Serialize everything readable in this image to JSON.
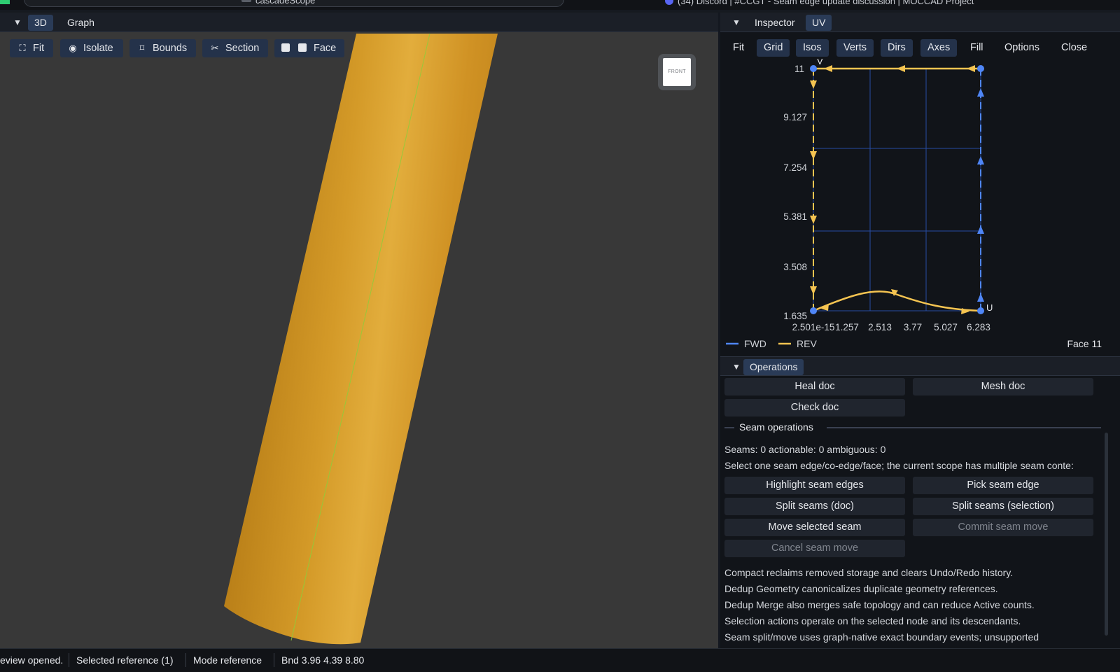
{
  "window": {
    "tab_title": "cascadeScope",
    "right_title": "(34) Discord | #CCGT - Seam edge update discussion | MOCCAD Project"
  },
  "left_panel": {
    "tabs": [
      {
        "label": "3D",
        "active": true
      },
      {
        "label": "Graph",
        "active": false
      }
    ],
    "toolbar": [
      {
        "label": "Fit",
        "icon": "fit-frame-icon"
      },
      {
        "label": "Isolate",
        "icon": "eye-icon"
      },
      {
        "label": "Bounds",
        "icon": "bounds-icon"
      },
      {
        "label": "Section",
        "icon": "scissors-icon"
      },
      {
        "label": "Face",
        "icon": "checkbox-icon"
      }
    ],
    "viewcube_label": "FRONT",
    "model_color": "#d49a28",
    "viewport_bg": "#383838"
  },
  "inspector": {
    "tabs": [
      {
        "label": "Inspector",
        "active": false
      },
      {
        "label": "UV",
        "active": true
      }
    ],
    "uv_toolbar": [
      {
        "label": "Fit",
        "on": false
      },
      {
        "label": "Grid",
        "on": true
      },
      {
        "label": "Isos",
        "on": true
      },
      {
        "label": "Verts",
        "on": true
      },
      {
        "label": "Dirs",
        "on": true
      },
      {
        "label": "Axes",
        "on": true
      },
      {
        "label": "Fill",
        "on": false
      },
      {
        "label": "Options",
        "on": false
      },
      {
        "label": "Close",
        "on": false
      }
    ],
    "uv_plot": {
      "axis_v_label": "V",
      "axis_u_label": "U",
      "y_ticks": [
        "11",
        "9.127",
        "7.254",
        "5.381",
        "3.508",
        "1.635"
      ],
      "x_ticks": [
        "2.501e-15",
        "1.257",
        "2.513",
        "3.77",
        "5.027",
        "6.283"
      ],
      "legend": [
        {
          "label": "FWD",
          "color": "#4f86f7"
        },
        {
          "label": "REV",
          "color": "#f5c451"
        }
      ],
      "face_label": "Face 11",
      "fwd_color": "#4f86f7",
      "rev_color": "#f5c451"
    }
  },
  "operations": {
    "title": "Operations",
    "buttons_top": [
      "Heal doc",
      "Mesh doc",
      "Check doc"
    ],
    "seam_section_title": "Seam operations",
    "seam_stats": "Seams: 0  actionable: 0  ambiguous: 0",
    "seam_hint": "Select one seam edge/co-edge/face; the current scope has multiple seam conte:",
    "seam_buttons": [
      {
        "label": "Highlight seam edges",
        "enabled": true
      },
      {
        "label": "Pick seam edge",
        "enabled": true
      },
      {
        "label": "Split seams (doc)",
        "enabled": true
      },
      {
        "label": "Split seams (selection)",
        "enabled": true
      },
      {
        "label": "Move selected seam",
        "enabled": true
      },
      {
        "label": "Commit seam move",
        "enabled": false
      },
      {
        "label": "Cancel seam move",
        "enabled": false
      }
    ],
    "notes": [
      "Compact reclaims removed storage and clears Undo/Redo history.",
      "Dedup Geometry canonicalizes duplicate geometry references.",
      "Dedup Merge also merges safe topology and can reduce Active counts.",
      "Selection actions operate on the selected node and its descendants.",
      "Seam split/move uses graph-native exact boundary events; unsupported"
    ]
  },
  "status_bar": {
    "message": "eview opened.",
    "selection": "Selected reference (1)",
    "mode": "Mode reference",
    "bounds": "Bnd 3.96 4.39 8.80"
  }
}
